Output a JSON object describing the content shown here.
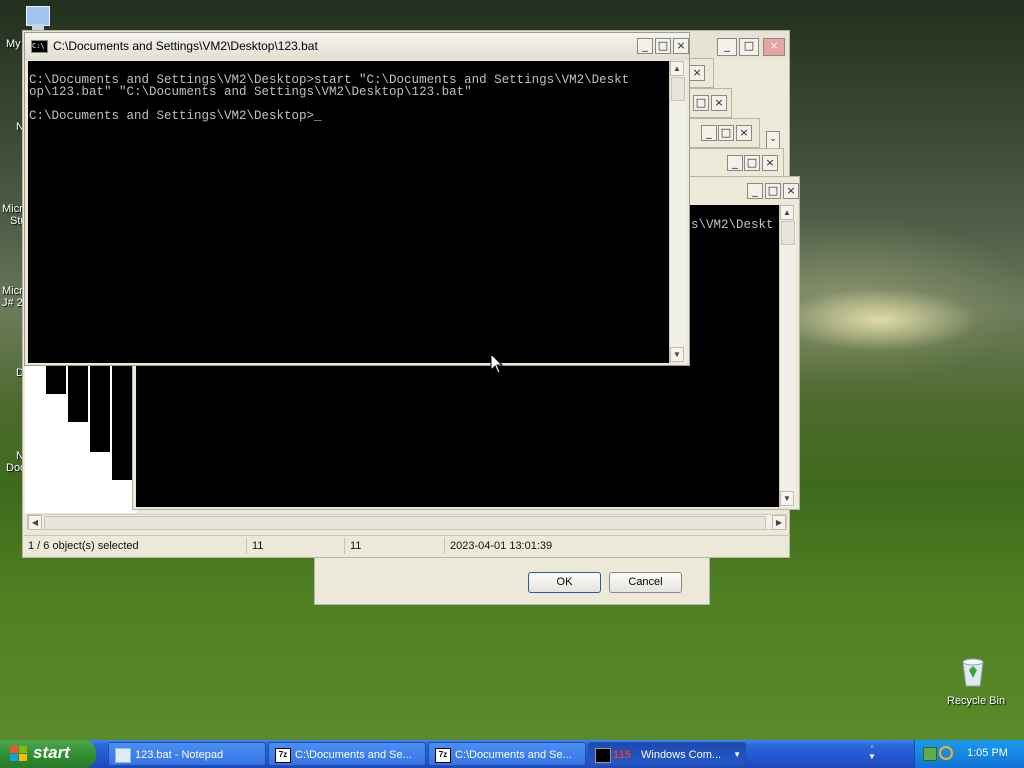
{
  "cmd_active": {
    "title": "C:\\Documents and Settings\\VM2\\Desktop\\123.bat",
    "lines": [
      "C:\\Documents and Settings\\VM2\\Desktop>start \"C:\\Documents and Settings\\VM2\\Deskt",
      "op\\123.bat\" \"C:\\Documents and Settings\\VM2\\Desktop\\123.bat\"",
      "",
      "C:\\Documents and Settings\\VM2\\Desktop>_"
    ]
  },
  "cmd_behind": {
    "visible_text": "s\\VM2\\Deskt"
  },
  "explorer": {
    "status": {
      "selection": "1 / 6 object(s) selected",
      "size": "11",
      "packed": "11",
      "modified": "2023-04-01 13:01:39"
    }
  },
  "dialog": {
    "ok_label": "OK",
    "cancel_label": "Cancel"
  },
  "desktop_icons": {
    "recycle_bin": "Recycle Bin",
    "my_computer_fragment": "My",
    "fragments": [
      "N",
      "Micro",
      "Stu",
      "Micro",
      "J# 2",
      "D",
      "N",
      "Doc"
    ]
  },
  "taskbar": {
    "start_label": "start",
    "tasks": [
      {
        "label": "123.bat - Notepad",
        "icon": "notepad-icon"
      },
      {
        "label": "C:\\Documents and Se...",
        "icon": "7zip-icon"
      },
      {
        "label": "C:\\Documents and Se...",
        "icon": "7zip-icon"
      },
      {
        "label": "Windows Com...",
        "icon": "cmd-icon",
        "count": "115"
      }
    ],
    "clock": "1:05 PM"
  },
  "window_buttons": {
    "minimize": "_",
    "maximize": "□",
    "close": "×"
  }
}
